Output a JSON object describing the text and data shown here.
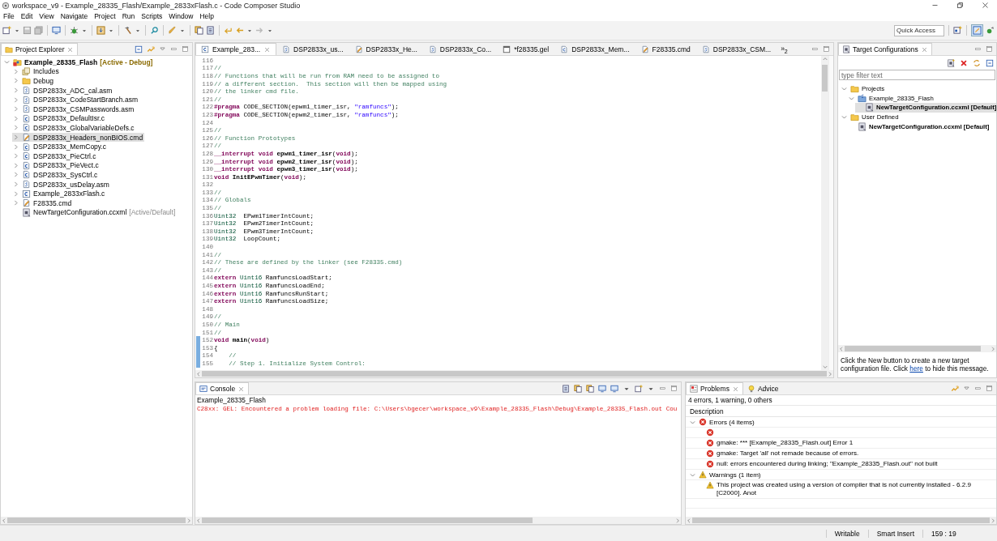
{
  "window": {
    "title": "workspace_v9 - Example_28335_Flash/Example_2833xFlash.c - Code Composer Studio"
  },
  "menu": [
    "File",
    "Edit",
    "View",
    "Navigate",
    "Project",
    "Run",
    "Scripts",
    "Window",
    "Help"
  ],
  "quick_access": {
    "placeholder": "Quick Access"
  },
  "project_explorer": {
    "tab": {
      "label": "Project Explorer",
      "selected": true
    },
    "tree": [
      {
        "label": "Example_28335_Flash",
        "suffix": "[Active - Debug]",
        "kind": "project",
        "expanded": true,
        "selected": false,
        "children": [
          {
            "label": "Includes",
            "kind": "includes",
            "expanded": false,
            "selected": false
          },
          {
            "label": "Debug",
            "kind": "folder",
            "expanded": false,
            "selected": false
          },
          {
            "label": "DSP2833x_ADC_cal.asm",
            "kind": "asm",
            "expanded": false,
            "selected": false
          },
          {
            "label": "DSP2833x_CodeStartBranch.asm",
            "kind": "asm",
            "expanded": false,
            "selected": false
          },
          {
            "label": "DSP2833x_CSMPasswords.asm",
            "kind": "asm",
            "expanded": false,
            "selected": false
          },
          {
            "label": "DSP2833x_DefaultIsr.c",
            "kind": "c",
            "expanded": false,
            "selected": false
          },
          {
            "label": "DSP2833x_GlobalVariableDefs.c",
            "kind": "c",
            "expanded": false,
            "selected": false
          },
          {
            "label": "DSP2833x_Headers_nonBIOS.cmd",
            "kind": "cmd",
            "expanded": false,
            "selected": true
          },
          {
            "label": "DSP2833x_MemCopy.c",
            "kind": "c",
            "expanded": false,
            "selected": false
          },
          {
            "label": "DSP2833x_PieCtrl.c",
            "kind": "c",
            "expanded": false,
            "selected": false
          },
          {
            "label": "DSP2833x_PieVect.c",
            "kind": "c",
            "expanded": false,
            "selected": false
          },
          {
            "label": "DSP2833x_SysCtrl.c",
            "kind": "c",
            "expanded": false,
            "selected": false
          },
          {
            "label": "DSP2833x_usDelay.asm",
            "kind": "asm",
            "expanded": false,
            "selected": false
          },
          {
            "label": "Example_2833xFlash.c",
            "kind": "csrc",
            "expanded": false,
            "selected": false
          },
          {
            "label": "F28335.cmd",
            "kind": "cmd",
            "expanded": false,
            "selected": false
          },
          {
            "label": "NewTargetConfiguration.ccxml",
            "suffix": "[Active/Default]",
            "kind": "ccxml",
            "selected": false
          }
        ]
      }
    ]
  },
  "editor": {
    "tabs": [
      {
        "label": "Example_283...",
        "kind": "csrc",
        "selected": true
      },
      {
        "label": "DSP2833x_us...",
        "kind": "asm",
        "selected": false
      },
      {
        "label": "DSP2833x_He...",
        "kind": "cmd",
        "selected": false
      },
      {
        "label": "DSP2833x_Co...",
        "kind": "asm",
        "selected": false
      },
      {
        "label": "*f28335.gel",
        "kind": "gel",
        "selected": false
      },
      {
        "label": "DSP2833x_Mem...",
        "kind": "c",
        "selected": false
      },
      {
        "label": "F28335.cmd",
        "kind": "cmd",
        "selected": false
      },
      {
        "label": "DSP2833x_CSM...",
        "kind": "asm",
        "selected": false
      }
    ],
    "overflow": "»$_{2}$",
    "lines": [
      {
        "num": "116",
        "marked": false
      },
      {
        "num": "117",
        "marked": false,
        "tokens": [
          {
            "kind": "comment",
            "text": "//"
          }
        ]
      },
      {
        "num": "118",
        "marked": false,
        "tokens": [
          {
            "kind": "comment",
            "text": "// Functions that will be run from RAM need to be assigned to"
          }
        ]
      },
      {
        "num": "119",
        "marked": false,
        "tokens": [
          {
            "kind": "comment",
            "text": "// a different section.  This section will then be mapped using"
          }
        ]
      },
      {
        "num": "120",
        "marked": false,
        "tokens": [
          {
            "kind": "comment",
            "text": "// the linker cmd file."
          }
        ]
      },
      {
        "num": "121",
        "marked": false,
        "tokens": [
          {
            "kind": "comment",
            "text": "//"
          }
        ]
      },
      {
        "num": "122",
        "marked": false,
        "tokens": [
          {
            "kind": "keyword",
            "text": "#pragma"
          },
          {
            "kind": "plain",
            "text": " CODE_SECTION(epwm1_timer_isr, "
          },
          {
            "kind": "string",
            "text": "\"ramfuncs\""
          },
          {
            "kind": "plain",
            "text": ");"
          }
        ]
      },
      {
        "num": "123",
        "marked": false,
        "tokens": [
          {
            "kind": "keyword",
            "text": "#pragma"
          },
          {
            "kind": "plain",
            "text": " CODE_SECTION(epwm2_timer_isr, "
          },
          {
            "kind": "string",
            "text": "\"ramfuncs\""
          },
          {
            "kind": "plain",
            "text": ");"
          }
        ]
      },
      {
        "num": "124",
        "marked": false
      },
      {
        "num": "125",
        "marked": false,
        "tokens": [
          {
            "kind": "comment",
            "text": "//"
          }
        ]
      },
      {
        "num": "126",
        "marked": false,
        "tokens": [
          {
            "kind": "comment",
            "text": "// Function Prototypes"
          }
        ]
      },
      {
        "num": "127",
        "marked": false,
        "tokens": [
          {
            "kind": "comment",
            "text": "//"
          }
        ]
      },
      {
        "num": "128",
        "marked": false,
        "tokens": [
          {
            "kind": "keyword",
            "text": "__interrupt void "
          },
          {
            "kind": "ident",
            "text": "epwm1_timer_isr"
          },
          {
            "kind": "plain",
            "text": "("
          },
          {
            "kind": "keyword",
            "text": "void"
          },
          {
            "kind": "plain",
            "text": ");"
          }
        ]
      },
      {
        "num": "129",
        "marked": false,
        "tokens": [
          {
            "kind": "keyword",
            "text": "__interrupt void "
          },
          {
            "kind": "ident",
            "text": "epwm2_timer_isr"
          },
          {
            "kind": "plain",
            "text": "("
          },
          {
            "kind": "keyword",
            "text": "void"
          },
          {
            "kind": "plain",
            "text": ");"
          }
        ]
      },
      {
        "num": "130",
        "marked": false,
        "tokens": [
          {
            "kind": "keyword",
            "text": "__interrupt void "
          },
          {
            "kind": "ident",
            "text": "epwm3_timer_isr"
          },
          {
            "kind": "plain",
            "text": "("
          },
          {
            "kind": "keyword",
            "text": "void"
          },
          {
            "kind": "plain",
            "text": ");"
          }
        ]
      },
      {
        "num": "131",
        "marked": false,
        "tokens": [
          {
            "kind": "keyword",
            "text": "void "
          },
          {
            "kind": "ident",
            "text": "InitEPwmTimer"
          },
          {
            "kind": "plain",
            "text": "("
          },
          {
            "kind": "keyword",
            "text": "void"
          },
          {
            "kind": "plain",
            "text": ");"
          }
        ]
      },
      {
        "num": "132",
        "marked": false
      },
      {
        "num": "133",
        "marked": false,
        "tokens": [
          {
            "kind": "comment",
            "text": "//"
          }
        ]
      },
      {
        "num": "134",
        "marked": false,
        "tokens": [
          {
            "kind": "comment",
            "text": "// Globals"
          }
        ]
      },
      {
        "num": "135",
        "marked": false,
        "tokens": [
          {
            "kind": "comment",
            "text": "//"
          }
        ]
      },
      {
        "num": "136",
        "marked": false,
        "tokens": [
          {
            "kind": "type",
            "text": "Uint32"
          },
          {
            "kind": "plain",
            "text": "  EPwm1TimerIntCount;"
          }
        ]
      },
      {
        "num": "137",
        "marked": false,
        "tokens": [
          {
            "kind": "type",
            "text": "Uint32"
          },
          {
            "kind": "plain",
            "text": "  EPwm2TimerIntCount;"
          }
        ]
      },
      {
        "num": "138",
        "marked": false,
        "tokens": [
          {
            "kind": "type",
            "text": "Uint32"
          },
          {
            "kind": "plain",
            "text": "  EPwm3TimerIntCount;"
          }
        ]
      },
      {
        "num": "139",
        "marked": false,
        "tokens": [
          {
            "kind": "type",
            "text": "Uint32"
          },
          {
            "kind": "plain",
            "text": "  LoopCount;"
          }
        ]
      },
      {
        "num": "140",
        "marked": false
      },
      {
        "num": "141",
        "marked": false,
        "tokens": [
          {
            "kind": "comment",
            "text": "//"
          }
        ]
      },
      {
        "num": "142",
        "marked": false,
        "tokens": [
          {
            "kind": "comment",
            "text": "// These are defined by the linker (see F28335.cmd)"
          }
        ]
      },
      {
        "num": "143",
        "marked": false,
        "tokens": [
          {
            "kind": "comment",
            "text": "//"
          }
        ]
      },
      {
        "num": "144",
        "marked": false,
        "tokens": [
          {
            "kind": "keyword",
            "text": "extern "
          },
          {
            "kind": "type",
            "text": "Uint16"
          },
          {
            "kind": "plain",
            "text": " RamfuncsLoadStart;"
          }
        ]
      },
      {
        "num": "145",
        "marked": false,
        "tokens": [
          {
            "kind": "keyword",
            "text": "extern "
          },
          {
            "kind": "type",
            "text": "Uint16"
          },
          {
            "kind": "plain",
            "text": " RamfuncsLoadEnd;"
          }
        ]
      },
      {
        "num": "146",
        "marked": false,
        "tokens": [
          {
            "kind": "keyword",
            "text": "extern "
          },
          {
            "kind": "type",
            "text": "Uint16"
          },
          {
            "kind": "plain",
            "text": " RamfuncsRunStart;"
          }
        ]
      },
      {
        "num": "147",
        "marked": false,
        "tokens": [
          {
            "kind": "keyword",
            "text": "extern "
          },
          {
            "kind": "type",
            "text": "Uint16"
          },
          {
            "kind": "plain",
            "text": " RamfuncsLoadSize;"
          }
        ]
      },
      {
        "num": "148",
        "marked": false
      },
      {
        "num": "149",
        "marked": false,
        "tokens": [
          {
            "kind": "comment",
            "text": "//"
          }
        ]
      },
      {
        "num": "150",
        "marked": false,
        "tokens": [
          {
            "kind": "comment",
            "text": "// Main"
          }
        ]
      },
      {
        "num": "151",
        "marked": false,
        "tokens": [
          {
            "kind": "comment",
            "text": "//"
          }
        ]
      },
      {
        "num": "152",
        "marked": true,
        "tokens": [
          {
            "kind": "keyword",
            "text": "void "
          },
          {
            "kind": "ident",
            "text": "main"
          },
          {
            "kind": "plain",
            "text": "("
          },
          {
            "kind": "keyword",
            "text": "void"
          },
          {
            "kind": "plain",
            "text": ")"
          }
        ]
      },
      {
        "num": "153",
        "marked": true,
        "tokens": [
          {
            "kind": "plain",
            "text": "{"
          }
        ]
      },
      {
        "num": "154",
        "marked": true,
        "tokens": [
          {
            "kind": "comment",
            "text": "    //"
          }
        ]
      },
      {
        "num": "155",
        "marked": true,
        "tokens": [
          {
            "kind": "comment",
            "text": "    // Step 1. Initialize System Control:"
          }
        ]
      }
    ]
  },
  "target_configurations": {
    "tab": {
      "label": "Target Configurations",
      "selected": true
    },
    "filter": {
      "placeholder": "type filter text"
    },
    "tree": [
      {
        "label": "Projects",
        "kind": "folder",
        "expanded": true,
        "selected": false,
        "children": [
          {
            "label": "Example_28335_Flash",
            "kind": "project-folder",
            "expanded": true,
            "selected": false,
            "children": [
              {
                "label": "NewTargetConfiguration.ccxml [Default]",
                "kind": "ccxml",
                "selected": true
              }
            ]
          }
        ]
      },
      {
        "label": "User Defined",
        "kind": "folder",
        "expanded": true,
        "selected": false,
        "children": [
          {
            "label": "NewTargetConfiguration.ccxml [Default]",
            "kind": "ccxml",
            "selected": false
          }
        ]
      }
    ],
    "message": {
      "before": "Click the New button to create a new target configuration file. Click ",
      "link": "here",
      "after": " to hide this message."
    }
  },
  "console": {
    "tab": {
      "label": "Console",
      "selected": true
    },
    "title": "Example_28335_Flash",
    "lines": [
      {
        "kind": "error",
        "text": "C28xx: GEL: Encountered a problem loading file: C:\\Users\\bgecer\\workspace_v9\\Example_28335_Flash\\Debug\\Example_28335_Flash.out Cou"
      }
    ]
  },
  "problems": {
    "tabs": [
      {
        "label": "Problems",
        "kind": "problems",
        "selected": true
      },
      {
        "label": "Advice",
        "kind": "advice",
        "selected": false
      }
    ],
    "summary": "4 errors, 1 warning, 0 others",
    "columns": [
      "Description"
    ],
    "groups": [
      {
        "label": "Errors (4 items)",
        "kind": "error",
        "expanded": true,
        "items": [
          {
            "kind": "error"
          },
          {
            "kind": "error",
            "text": "gmake: *** [Example_28335_Flash.out] Error 1"
          },
          {
            "kind": "error",
            "text": "gmake: Target 'all' not remade because of errors."
          },
          {
            "kind": "error",
            "text": "null: errors encountered during linking; \"Example_28335_Flash.out\" not built"
          }
        ]
      },
      {
        "label": "Warnings (1 item)",
        "kind": "warning",
        "expanded": true,
        "items": [
          {
            "kind": "warning",
            "text": "This project was created using a version of compiler that is not currently installed - 6.2.9 [C2000]. Anot"
          }
        ]
      }
    ]
  },
  "status_bar": [
    "Writable",
    "Smart Insert",
    "159 : 19"
  ]
}
